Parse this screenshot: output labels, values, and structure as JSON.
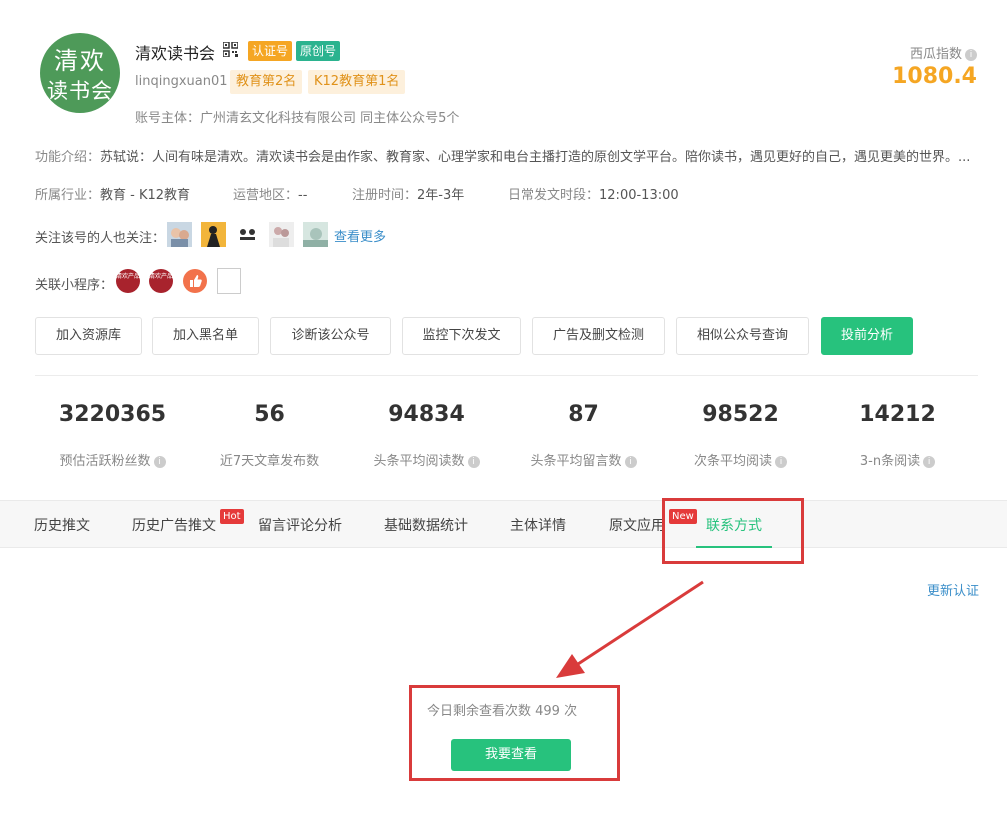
{
  "account": {
    "avatar_line1": "清欢",
    "avatar_line2": "读书会",
    "name": "清欢读书会",
    "tag_auth": "认证号",
    "tag_original": "原创号",
    "uid": "linqingxuan01",
    "rank_1": "教育第2名",
    "rank_2": "K12教育第1名",
    "owner": "账号主体：广州清玄文化科技有限公司 同主体公众号5个"
  },
  "index": {
    "label": "西瓜指数",
    "value": "1080.4"
  },
  "intro": {
    "label": "功能介绍：",
    "text": "苏轼说：人间有味是清欢。清欢读书会是由作家、教育家、心理学家和电台主播打造的原创文学平台。陪你读书，遇见更好的自己，遇见更美的世界。..."
  },
  "meta": {
    "industry_label": "所属行业：",
    "industry": "教育 - K12教育",
    "region_label": "运营地区：",
    "region": "--",
    "reg_label": "注册时间：",
    "reg": "2年-3年",
    "post_label": "日常发文时段：",
    "post": "12:00-13:00"
  },
  "followers": {
    "label": "关注该号的人也关注：",
    "more": "查看更多"
  },
  "mini": {
    "label": "关联小程序：",
    "badge_text": "清欢产品"
  },
  "actions": [
    "加入资源库",
    "加入黑名单",
    "诊断该公众号",
    "监控下次发文",
    "广告及删文检测",
    "相似公众号查询",
    "投前分析"
  ],
  "stats": [
    {
      "value": "3220365",
      "label": "预估活跃粉丝数"
    },
    {
      "value": "56",
      "label": "近7天文章发布数"
    },
    {
      "value": "94834",
      "label": "头条平均阅读数"
    },
    {
      "value": "87",
      "label": "头条平均留言数"
    },
    {
      "value": "98522",
      "label": "次条平均阅读"
    },
    {
      "value": "14212",
      "label": "3-n条阅读"
    }
  ],
  "tabs": [
    "历史推文",
    "历史广告推文",
    "留言评论分析",
    "基础数据统计",
    "主体详情",
    "原文应用",
    "联系方式"
  ],
  "badges": {
    "hot": "Hot",
    "new": "New"
  },
  "update_link": "更新认证",
  "contact": {
    "remaining": "今日剩余查看次数 499 次",
    "view_button": "我要查看"
  },
  "colors": {
    "accent": "#27c27d",
    "highlight": "#d93b3b",
    "index": "#f5a623"
  }
}
